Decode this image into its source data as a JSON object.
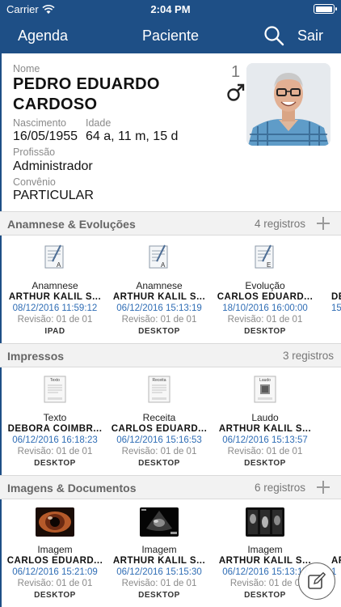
{
  "status": {
    "carrier": "Carrier",
    "time": "2:04 PM"
  },
  "nav": {
    "left": "Agenda",
    "title": "Paciente",
    "right": "Sair"
  },
  "patient": {
    "name_label": "Nome",
    "name": "PEDRO EDUARDO CARDOSO",
    "birth_label": "Nascimento",
    "birth": "16/05/1955",
    "age_label": "Idade",
    "age": "64 a, 11 m, 15 d",
    "profession_label": "Profissão",
    "profession": "Administrador",
    "insurance_label": "Convênio",
    "insurance": "PARTICULAR",
    "number": "1",
    "gender_icon": "male-icon",
    "photo_icon": "avatar-photo"
  },
  "sections": [
    {
      "title": "Anamnese & Evoluções",
      "count": "4 registros",
      "items": [
        {
          "type": "Anamnese",
          "author": "ARTHUR KALIL S...",
          "date": "08/12/2016 11:59:12",
          "revision": "Revisão: 01 de 01",
          "device": "IPAD",
          "icon": "form-document-icon"
        },
        {
          "type": "Anamnese",
          "author": "ARTHUR KALIL S...",
          "date": "06/12/2016 15:13:19",
          "revision": "Revisão: 01 de 01",
          "device": "DESKTOP",
          "icon": "form-document-icon"
        },
        {
          "type": "Evolução",
          "author": "CARLOS EDUARD...",
          "date": "18/10/2016 16:00:00",
          "revision": "Revisão: 01 de 01",
          "device": "DESKTOP",
          "icon": "evolution-document-icon"
        },
        {
          "type": "",
          "author": "DÉ",
          "date": "15",
          "revision": "",
          "device": "",
          "icon": "form-document-icon"
        }
      ]
    },
    {
      "title": "Impressos",
      "count": "3 registros",
      "items": [
        {
          "type": "Texto",
          "author": "DÉBORA COIMBR...",
          "date": "06/12/2016 16:18:23",
          "revision": "Revisão: 01 de 01",
          "device": "DESKTOP",
          "icon": "text-print-icon",
          "doc_tag": "Texto"
        },
        {
          "type": "Receita",
          "author": "CARLOS EDUARD...",
          "date": "06/12/2016 15:16:53",
          "revision": "Revisão: 01 de 01",
          "device": "DESKTOP",
          "icon": "prescription-print-icon",
          "doc_tag": "Receita"
        },
        {
          "type": "Laudo",
          "author": "ARTHUR KALIL S...",
          "date": "06/12/2016 15:13:57",
          "revision": "Revisão: 01 de 01",
          "device": "DESKTOP",
          "icon": "report-print-icon",
          "doc_tag": "Laudo"
        }
      ]
    },
    {
      "title": "Imagens & Documentos",
      "count": "6 registros",
      "items": [
        {
          "type": "Imagem",
          "author": "CARLOS EDUARD...",
          "date": "06/12/2016 15:21:09",
          "revision": "Revisão: 01 de 01",
          "device": "DESKTOP",
          "icon": "eye-image-thumbnail"
        },
        {
          "type": "Imagem",
          "author": "ARTHUR KALIL S...",
          "date": "06/12/2016 15:15:30",
          "revision": "Revisão: 01 de 01",
          "device": "DESKTOP",
          "icon": "ultrasound-image-thumbnail"
        },
        {
          "type": "Imagem",
          "author": "ARTHUR KALIL S...",
          "date": "06/12/2016 15:13:17",
          "revision": "Revisão: 01 de 0",
          "device": "DESKTOP",
          "icon": "scan-image-thumbnail"
        },
        {
          "type": "",
          "author": "AR",
          "date": "1",
          "revision": "",
          "device": "",
          "icon": "scan-image-thumbnail"
        }
      ]
    }
  ],
  "colors": {
    "nav": "#1e4f86",
    "date": "#2f6db5",
    "section_bg": "#f2f2f2"
  }
}
